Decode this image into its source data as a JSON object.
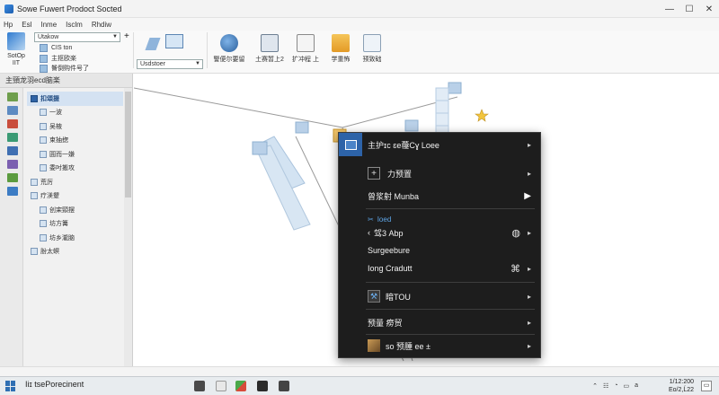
{
  "window": {
    "title": "Sowe Fuwert Prodoct Socted"
  },
  "menu": [
    "Hp",
    "Esl",
    "Inme",
    "Isclm",
    "Rhdiw"
  ],
  "ribbon": {
    "setup_label": "SotOp\nIIT",
    "combo_top": "Utakow",
    "small_items": [
      "CIS ton",
      "主抠欧楽",
      "鬠倒购件号了"
    ],
    "combo_bottom": "Usdstoer",
    "tools": [
      {
        "label": "警便尔要留",
        "icon": "mouse-icon"
      },
      {
        "label": "土赛暂上2",
        "icon": "gear-settings-icon"
      },
      {
        "label": "扩冲程  上",
        "icon": "document-check-icon"
      },
      {
        "label": "学重怖",
        "icon": "folder-icon"
      },
      {
        "label": "预致础",
        "icon": "clipboard-icon"
      }
    ]
  },
  "sidebar": {
    "header": "主頸龙羽ecd脑楽",
    "items": [
      {
        "label": "扣頌掇",
        "level": 0,
        "selected": true
      },
      {
        "label": "一波",
        "level": 1
      },
      {
        "label": "吴棭",
        "level": 1
      },
      {
        "label": "束抽揔",
        "level": 1
      },
      {
        "label": "圓而一嫌",
        "level": 1
      },
      {
        "label": "委吋搬攻",
        "level": 1
      },
      {
        "label": "荒厉",
        "level": 0
      },
      {
        "label": "疗渼顰",
        "level": 0
      },
      {
        "label": "创寀頸摆",
        "level": 1
      },
      {
        "label": "坊方篝",
        "level": 1
      },
      {
        "label": "坊乡瀧脑",
        "level": 1
      },
      {
        "label": "朌太螟",
        "level": 0
      }
    ]
  },
  "context_menu": {
    "items": [
      {
        "label": "主护ɪc ɛe蘉Cɣ Loee",
        "has_submenu": true
      },
      {
        "label": "力预置",
        "has_submenu": true,
        "icon": "plus-box-icon"
      },
      {
        "label": "曾浆射 Munba",
        "has_submenu": true
      },
      {
        "label": "Ioed",
        "accent": true
      },
      {
        "label": "驾3 Abp",
        "has_submenu": true,
        "right_icon": "shield-icon"
      },
      {
        "label": "Surgeebure",
        "has_submenu": false
      },
      {
        "label": "Iong Cradutt",
        "has_submenu": true,
        "right_icon": "grid-icon"
      },
      {
        "label": "暗TOU",
        "has_submenu": true,
        "icon": "tool-icon"
      },
      {
        "label": "预量 痨贸",
        "has_submenu": true
      },
      {
        "label": "so 预腫 ee  ±",
        "has_submenu": true,
        "icon": "image-icon"
      }
    ]
  },
  "taskbar": {
    "search": "Iiɪ tsePorecinent",
    "tray": [
      "⌃",
      "☷",
      "◔",
      "▭",
      "a"
    ],
    "time": "1/12:200",
    "date": "Eo/2,Ĺ22"
  },
  "colors": {
    "accent": "#2d63a8",
    "menu_bg": "#1d1d1d",
    "canvas_shape": "#c9dcee"
  }
}
